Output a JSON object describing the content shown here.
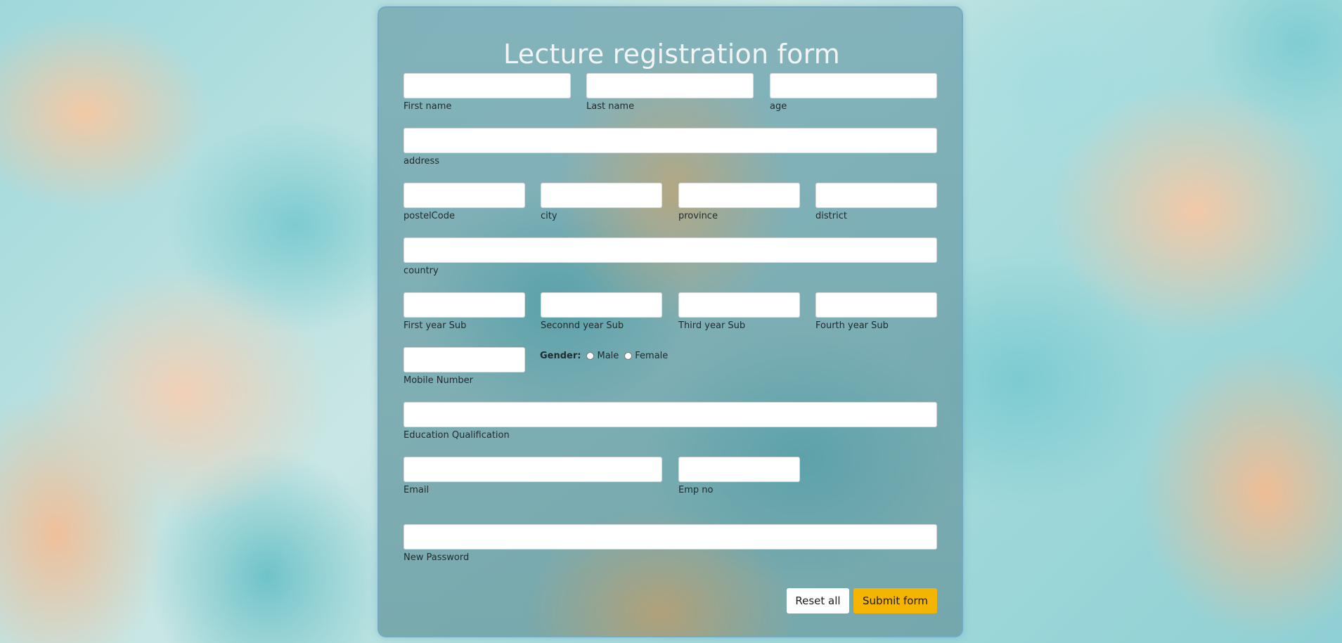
{
  "form": {
    "title": "Lecture registration form",
    "fields": {
      "first_name": {
        "label": "First name",
        "value": ""
      },
      "last_name": {
        "label": "Last name",
        "value": ""
      },
      "age": {
        "label": "age",
        "value": ""
      },
      "address": {
        "label": "address",
        "value": ""
      },
      "postal_code": {
        "label": "postelCode",
        "value": ""
      },
      "city": {
        "label": "city",
        "value": ""
      },
      "province": {
        "label": "province",
        "value": ""
      },
      "district": {
        "label": "district",
        "value": ""
      },
      "country": {
        "label": "country",
        "value": ""
      },
      "first_year_sub": {
        "label": "First year Sub",
        "value": ""
      },
      "second_year_sub": {
        "label": "Seconnd year Sub",
        "value": ""
      },
      "third_year_sub": {
        "label": "Third year Sub",
        "value": ""
      },
      "fourth_year_sub": {
        "label": "Fourth year Sub",
        "value": ""
      },
      "mobile_number": {
        "label": "Mobile Number",
        "value": ""
      },
      "education_qualification": {
        "label": "Education Qualification",
        "value": ""
      },
      "email": {
        "label": "Email",
        "value": ""
      },
      "emp_no": {
        "label": "Emp no",
        "value": ""
      },
      "new_password": {
        "label": "New Password",
        "value": ""
      }
    },
    "gender": {
      "label": "Gender:",
      "options": [
        "Male",
        "Female"
      ]
    },
    "buttons": {
      "reset": "Reset all",
      "submit": "Submit form"
    }
  },
  "colors": {
    "submit_button": "#f5b400",
    "title_text": "#f3f3f3",
    "card_border": "#6eaac8"
  }
}
